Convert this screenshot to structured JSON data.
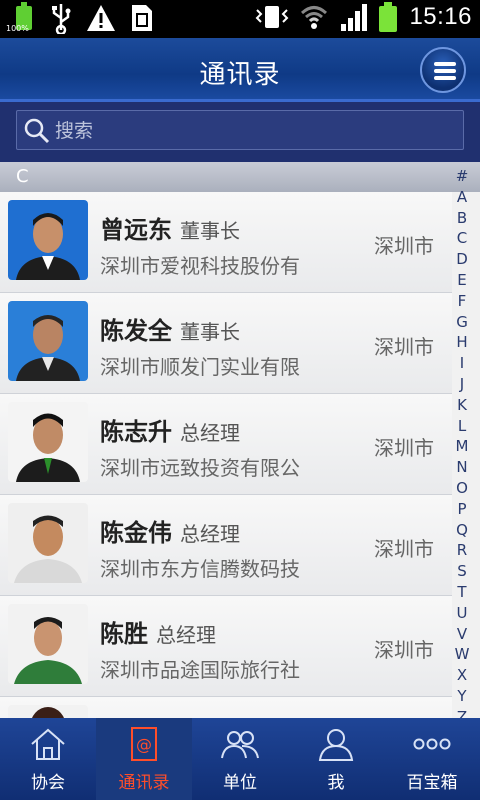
{
  "status_bar": {
    "battery_percent": "100%",
    "time": "15:16"
  },
  "header": {
    "title": "通讯录"
  },
  "search": {
    "placeholder": "搜索"
  },
  "section": {
    "letter": "C"
  },
  "contacts": [
    {
      "name": "曾远东",
      "role": "董事长",
      "company": "深圳市爱视科技股份有",
      "city": "深圳市"
    },
    {
      "name": "陈发全",
      "role": "董事长",
      "company": "深圳市顺发门实业有限",
      "city": "深圳市"
    },
    {
      "name": "陈志升",
      "role": "总经理",
      "company": "深圳市远致投资有限公",
      "city": "深圳市"
    },
    {
      "name": "陈金伟",
      "role": "总经理",
      "company": "深圳市东方信腾数码技",
      "city": "深圳市"
    },
    {
      "name": "陈胜",
      "role": "总经理",
      "company": "深圳市品途国际旅行社",
      "city": "深圳市"
    }
  ],
  "alphabet": [
    "#",
    "A",
    "B",
    "C",
    "D",
    "E",
    "F",
    "G",
    "H",
    "I",
    "J",
    "K",
    "L",
    "M",
    "N",
    "O",
    "P",
    "Q",
    "R",
    "S",
    "T",
    "U",
    "V",
    "W",
    "X",
    "Y",
    "Z"
  ],
  "tabs": [
    {
      "label": "协会",
      "icon": "home-icon"
    },
    {
      "label": "通讯录",
      "icon": "contacts-book-icon",
      "active": true
    },
    {
      "label": "单位",
      "icon": "group-icon"
    },
    {
      "label": "我",
      "icon": "user-icon"
    },
    {
      "label": "百宝箱",
      "icon": "more-dots-icon"
    }
  ],
  "colors": {
    "header_blue": "#0f3a86",
    "tab_active": "#ff4e2a",
    "battery_green": "#7be339"
  }
}
